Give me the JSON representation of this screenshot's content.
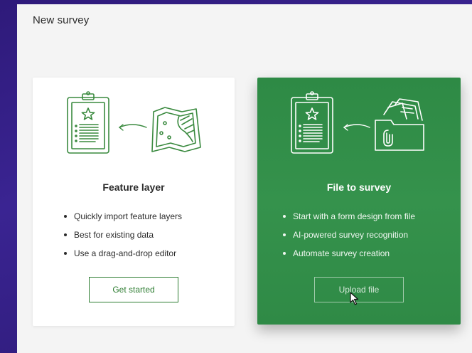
{
  "page": {
    "title": "New survey"
  },
  "cards": [
    {
      "id": "feature-layer",
      "title": "Feature layer",
      "bullets": [
        "Quickly import feature layers",
        "Best for existing data",
        "Use a drag-and-drop editor"
      ],
      "button_label": "Get started",
      "icons": [
        "clipboard-form-icon",
        "arrow-left-icon",
        "map-icon"
      ]
    },
    {
      "id": "file-to-survey",
      "title": "File to survey",
      "bullets": [
        "Start with a form design from file",
        "AI-powered survey recognition",
        "Automate survey creation"
      ],
      "button_label": "Upload file",
      "icons": [
        "clipboard-form-icon",
        "arrow-left-icon",
        "file-folder-icon"
      ]
    }
  ],
  "colors": {
    "background": "#3a2492",
    "panel": "#f4f4f4",
    "accent_green": "#2e8a45",
    "outline_green": "#2e7d32",
    "text_dark": "#2b2b2b"
  }
}
